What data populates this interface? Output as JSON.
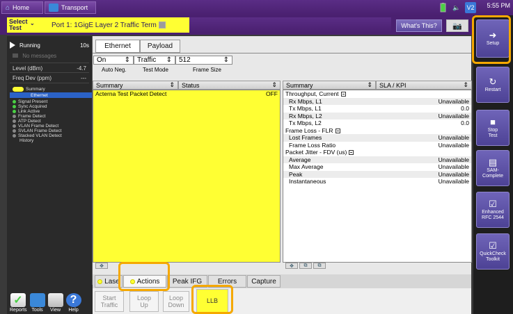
{
  "topbar": {
    "home_label": "Home",
    "transport_label": "Transport",
    "time": "5:55 PM",
    "icons": [
      "battery-icon",
      "speaker-icon",
      "vnc-icon"
    ],
    "vnc_label": "V2"
  },
  "header": {
    "select_test_label": "Select\nTest",
    "port_title": "Port 1: 1GigE Layer 2 Traffic Term",
    "whats_this": "What's This?"
  },
  "left": {
    "running_label": "Running",
    "running_time": "10s",
    "no_messages": "No messages",
    "level_label": "Level (dBm)",
    "level_value": "-4.7",
    "freq_label": "Freq Dev (ppm)",
    "freq_value": "---",
    "tree": {
      "summary": "Summary",
      "ethernet": "Ethernet",
      "items": [
        "Signal Present",
        "Sync Acquired",
        "Link Active",
        "Frame Detect",
        "ATP Detect",
        "VLAN Frame Detect",
        "SVLAN Frame Detect",
        "Stacked VLAN Detect",
        "History"
      ]
    },
    "bottom_icons": [
      "Reports",
      "Tools",
      "View",
      "Help"
    ]
  },
  "tabs": {
    "ethernet": "Ethernet",
    "payload": "Payload"
  },
  "selectors": {
    "auto_neg_value": "On",
    "auto_neg_label": "Auto Neg.",
    "test_mode_value": "Traffic",
    "test_mode_label": "Test Mode",
    "frame_size_value": "512",
    "frame_size_label": "Frame Size"
  },
  "left_summary": {
    "col1": "Summary",
    "col2": "Status",
    "row_label": "Acterna Test Packet Detect",
    "row_value": "OFF"
  },
  "right_summary": {
    "col1": "Summary",
    "col2": "SLA / KPI",
    "groups": [
      {
        "title": "Throughput, Current",
        "rows": [
          {
            "k": "Rx Mbps, L1",
            "v": "Unavailable"
          },
          {
            "k": "Tx Mbps, L1",
            "v": "0.0"
          },
          {
            "k": "Rx Mbps, L2",
            "v": "Unavailable"
          },
          {
            "k": "Tx Mbps, L2",
            "v": "0.0"
          }
        ]
      },
      {
        "title": "Frame Loss - FLR",
        "rows": [
          {
            "k": "Lost Frames",
            "v": "Unavailable"
          },
          {
            "k": "Frame Loss Ratio",
            "v": "Unavailable"
          }
        ]
      },
      {
        "title": "Packet Jitter - FDV (us)",
        "rows": [
          {
            "k": "Average",
            "v": "Unavailable"
          },
          {
            "k": "Max Average",
            "v": "Unavailable"
          },
          {
            "k": "Peak",
            "v": "Unavailable"
          },
          {
            "k": "Instantaneous",
            "v": "Unavailable"
          }
        ]
      }
    ]
  },
  "bottom_tabs": {
    "laser": "Lase",
    "actions": "Actions",
    "peak_ifg": "Peak IFG",
    "errors": "Errors",
    "capture": "Capture"
  },
  "action_buttons": {
    "start_traffic": "Start\nTraffic",
    "loop_up": "Loop\nUp",
    "loop_down": "Loop\nDown",
    "llb": "LLB"
  },
  "right_panel": {
    "setup": "Setup",
    "restart": "Restart",
    "stop_test": "Stop\nTest",
    "sam_complete": "SAM-\nComplete",
    "enhanced_rfc": "Enhanced\nRFC 2544",
    "quickcheck": "QuickCheck\nToolkit"
  },
  "colors": {
    "accent_purple": "#4a2070",
    "highlight_yellow": "#ffff33",
    "callout_orange": "#f5a800",
    "status_green": "#4ad044"
  }
}
